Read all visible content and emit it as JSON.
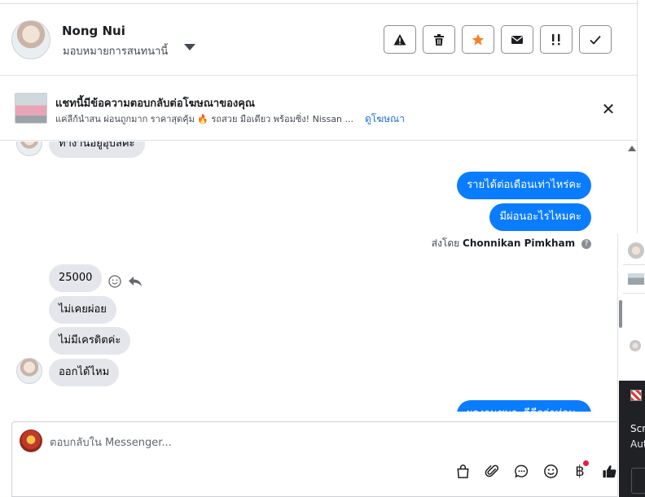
{
  "header": {
    "name": "Nong Nui",
    "assign_label": "มอบหมายการสนทนานี้",
    "actions": [
      {
        "name": "report-button",
        "icon": "warning-icon"
      },
      {
        "name": "delete-button",
        "icon": "trash-icon"
      },
      {
        "name": "star-button",
        "icon": "star-icon",
        "color": "#f5802a"
      },
      {
        "name": "mail-button",
        "icon": "envelope-icon"
      },
      {
        "name": "mark-urgent-button",
        "icon": "exclamation-icon"
      },
      {
        "name": "done-button",
        "icon": "checkmark-icon"
      }
    ]
  },
  "ad_banner": {
    "title": "แชทนี้มีข้อความตอบกลับต่อโฆษณาของคุณ",
    "description": "แค่ลีก้นำสน ผ่อนถูกมาก ราคาสุดคุ้ม 🔥 รถสวย มือเดียว พร้อมซิ่ง! Nissan ...",
    "link": "ดูโฆษณา"
  },
  "messages": [
    {
      "side": "in",
      "text": "ทำงานอยู่อุบลค่ะ"
    },
    {
      "side": "out",
      "text": "รายได้ต่อเดือนเท่าไหร่คะ"
    },
    {
      "side": "out",
      "text": "มีผ่อนอะไรไหมคะ"
    },
    {
      "side": "in",
      "text": "25000"
    },
    {
      "side": "in",
      "text": "ไม่เคยผ่อย"
    },
    {
      "side": "in",
      "text": "ไม่มีเครดิตค่ะ"
    },
    {
      "side": "in",
      "text": "ออกได้ไหม"
    },
    {
      "side": "out",
      "text": "ผลงานชมาะดีดีกว่าท่อนะ"
    }
  ],
  "sent_by": {
    "prefix": "ส่งโดย",
    "agent": "Chonnikan Pimkham"
  },
  "composer": {
    "placeholder": "ตอบกลับใน Messenger...",
    "tools": [
      "shopping-bag-icon",
      "paperclip-icon",
      "chat-bubble-icon",
      "emoji-icon",
      "baht-icon",
      "thumbs-up-icon"
    ]
  },
  "side_panel": {
    "line1": "Scr",
    "line2": "Aut"
  },
  "colors": {
    "outgoing_bubble": "#0a7cff",
    "incoming_bubble": "#e4e6eb",
    "link": "#216fdb",
    "star": "#f5802a",
    "notification_dot": "#e41e3f"
  }
}
